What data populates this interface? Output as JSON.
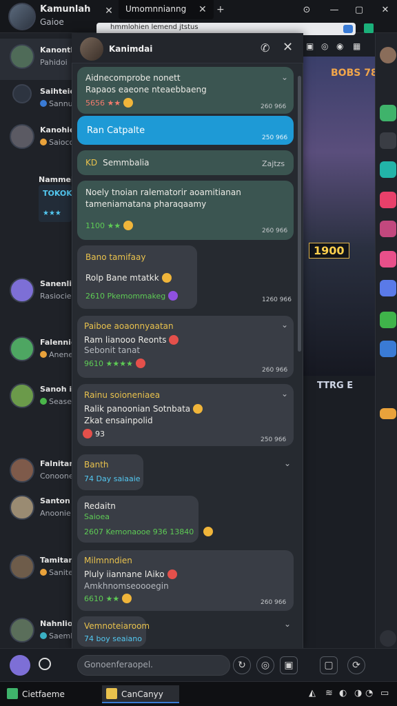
{
  "top": {
    "title": "Kamunlah",
    "subtitle": "Gaioe",
    "tab2_label": "Umomnnianng",
    "close_glyph": "✕",
    "new_tab_glyph": "+",
    "window_controls": [
      "⊙",
      "—",
      "▢",
      "✕"
    ]
  },
  "address": {
    "text": "hmmlohien lemend jtstus"
  },
  "contacts": [
    {
      "name": "Kanonth",
      "preview": "Pahidoi",
      "avatar_color": "#4f6b58",
      "dot_color": ""
    },
    {
      "name": "Saihteieh",
      "preview": "Sannunn",
      "avatar_color": "#2d3440",
      "dot_color": "#3a7bd5"
    },
    {
      "name": "Kanohiean",
      "preview": "Saioco",
      "avatar_color": "#5b5a63",
      "dot_color": "#e9a23b"
    },
    {
      "name": "Nammein",
      "preview": "",
      "avatar_color": "",
      "dot_color": ""
    },
    {
      "name": "Sanenlio",
      "preview": "Rasiocie",
      "avatar_color": "#7d6fd6",
      "dot_color": ""
    },
    {
      "name": "Falennie",
      "preview": "Anenelle",
      "avatar_color": "#4ea662",
      "dot_color": "#e9a23b"
    },
    {
      "name": "Sanoh ic",
      "preview": "Seaseide",
      "avatar_color": "#6b9a4a",
      "dot_color": "#4ab64a"
    },
    {
      "name": "Falnitan",
      "preview": "Conoone",
      "avatar_color": "#7e5a4a",
      "dot_color": ""
    },
    {
      "name": "Santon",
      "preview": "Anoonie",
      "avatar_color": "#9a8b72",
      "dot_color": ""
    },
    {
      "name": "Tamitan",
      "preview": "Sanite",
      "avatar_color": "#6e5c4a",
      "dot_color": "#e9a23b"
    },
    {
      "name": "Nahnlio",
      "preview": "Saemhi",
      "avatar_color": "#5a6e5a",
      "dot_color": "#3ab0c4"
    }
  ],
  "tokok": {
    "label": "TOKOK",
    "stars": "★★★"
  },
  "panel": {
    "title": "Kanimdai",
    "call_icon": "phone-icon",
    "close_glyph": "✕"
  },
  "messages": [
    {
      "title": "Aidnecomprobe nonett",
      "line": "Rapaos eaeone nteaebbaeng",
      "meta": "5656 ★★",
      "time": "260 966"
    },
    {
      "title": "Ran Catpalte",
      "time": "250 966"
    },
    {
      "title": "Semmbalia",
      "time": "Zajtzs",
      "prefix": "KD"
    },
    {
      "line1": "Noely tnoian ralematorir aoamitianan",
      "line2": "tameniamatana pharaqaamy",
      "meta": "1100 ★★",
      "time": "260 966"
    },
    {
      "title": "Bano tamifaay",
      "line": "Rolp Bane mtatkk",
      "meta": "2610 Pkemommakeg",
      "time": "1260 966"
    },
    {
      "title": "Paiboe aoaonnyaatan",
      "line1": "Ram lianooo Reonts",
      "line2": "Sebonit tanat",
      "meta": "9610 ★★★★",
      "time": "260 966"
    },
    {
      "title": "Rainu soioneniaea",
      "line1": "Ralik panoonian Sotnbata",
      "line2": "Zkat ensainpolid",
      "meta": "93",
      "time": "250 966"
    },
    {
      "title": "Banth",
      "meta": "74 Day saiaaie"
    },
    {
      "title": "Redaitn",
      "line": "Saioea",
      "meta": "2607 Kemonaooe 936 13840",
      "time": ""
    },
    {
      "title": "Milmnndien",
      "line1": "Pluly iiannane lAiko",
      "line2": "Amkhnomseoooegin",
      "meta": "6610 ★★",
      "time": "260 966"
    },
    {
      "title": "Vemnoteiaroom",
      "meta": "74 boy seaiano"
    }
  ],
  "composer": {
    "placeholder": "Gonoenferaopel."
  },
  "art": {
    "sign": "BOBS 78",
    "score": "1900",
    "foot": "TTRG E"
  },
  "taskbar": {
    "app1": "Cietfaeme",
    "app2": "CanCanyy"
  },
  "colors": {
    "accent": "#1e9ad6",
    "bubble_green": "#3b5551",
    "bubble_gray": "#393d45"
  }
}
